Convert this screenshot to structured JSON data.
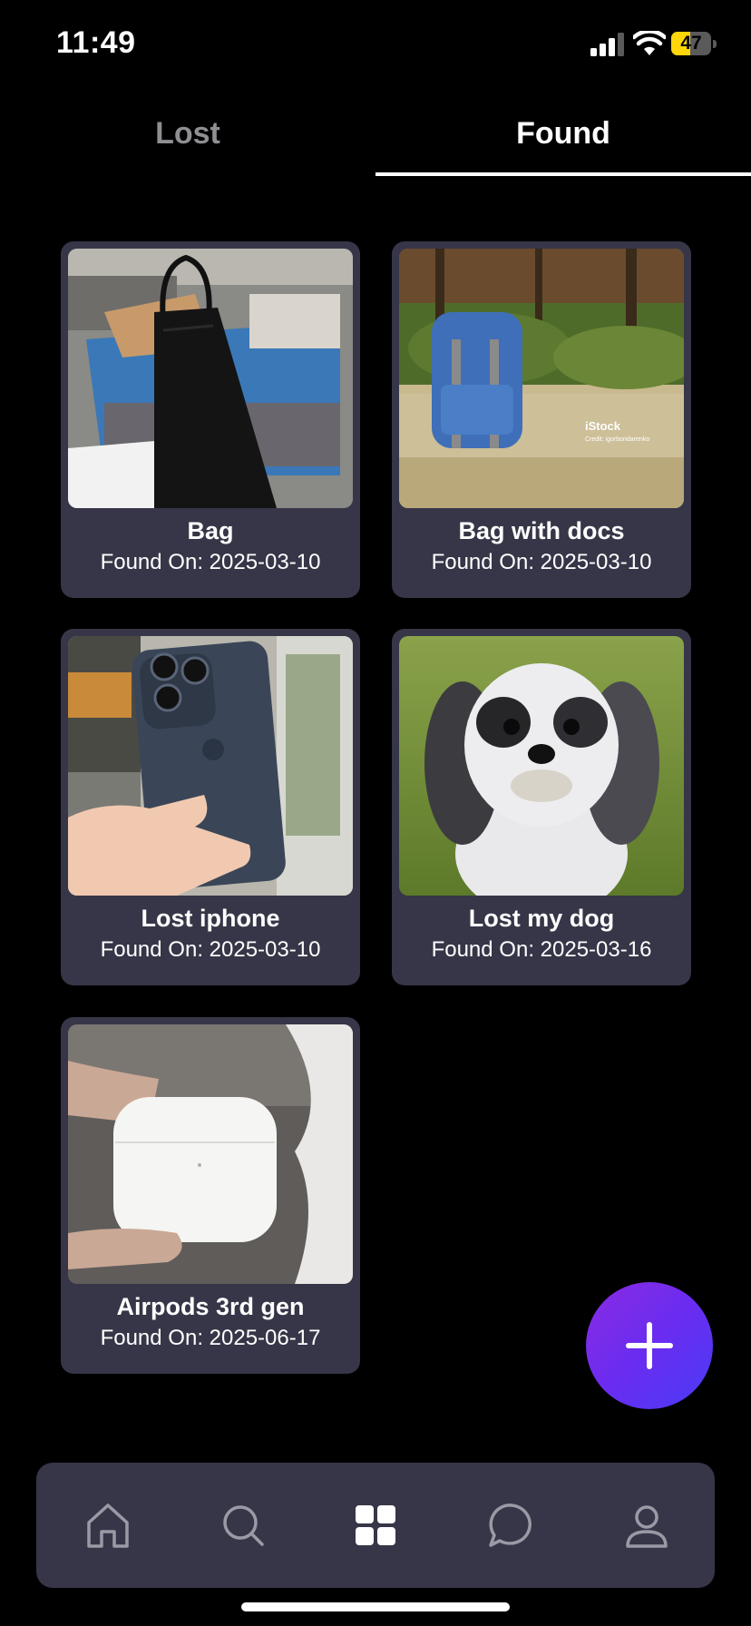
{
  "status_bar": {
    "time": "11:49",
    "battery": "47"
  },
  "tabs": {
    "lost_label": "Lost",
    "found_label": "Found",
    "active": "Found"
  },
  "items": [
    {
      "title": "Bag",
      "date_prefix": "Found On:",
      "date": "2025-03-10"
    },
    {
      "title": "Bag with docs",
      "date_prefix": "Found On:",
      "date": "2025-03-10"
    },
    {
      "title": "Lost iphone",
      "date_prefix": "Found On:",
      "date": "2025-03-10"
    },
    {
      "title": "Lost my dog",
      "date_prefix": "Found On:",
      "date": "2025-03-16"
    },
    {
      "title": "Airpods 3rd gen",
      "date_prefix": "Found On:",
      "date": "2025-06-17"
    }
  ],
  "photo_watermark": {
    "brand": "iStock",
    "credit": "Credit: igorbondarenko"
  },
  "fab": {
    "icon": "plus-icon"
  },
  "bottom_nav": [
    {
      "icon": "home-icon",
      "active": false
    },
    {
      "icon": "search-icon",
      "active": false
    },
    {
      "icon": "grid-icon",
      "active": true
    },
    {
      "icon": "chat-icon",
      "active": false
    },
    {
      "icon": "profile-icon",
      "active": false
    }
  ],
  "colors": {
    "background": "#000000",
    "card": "#363648",
    "accent": "#6a2cf0",
    "inactive_tab": "#8e8e93",
    "icon_inactive": "#9a9aa6"
  }
}
